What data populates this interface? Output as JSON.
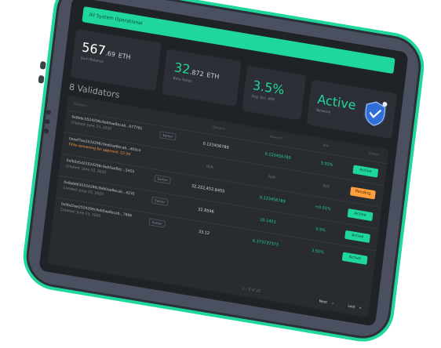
{
  "banner": {
    "text": "All System Operational"
  },
  "stats": [
    {
      "value": "567",
      "fraction": ".69",
      "unit": "ETH",
      "label": "Sum Balance"
    },
    {
      "value": "32",
      "fraction": ".872",
      "unit": "ETH",
      "label": "Beta Rates"
    },
    {
      "value": "3.5%",
      "label": "Avg. Est. APR"
    },
    {
      "value": "Active",
      "label": "Network"
    }
  ],
  "validators_title": "8 Validators",
  "table": {
    "headers": [
      "Validator",
      "Balance",
      "Reward",
      "APR",
      "Status"
    ],
    "rows": [
      {
        "id": "0x8ebc5524296c9eb0ae8ecab...077781",
        "sub": "Created: June 23, 2020",
        "tag": "Earlier",
        "balance": "0.123456789",
        "reward": "0.123456789",
        "apr": "3.55%",
        "status": "Active"
      },
      {
        "id": "0xeef7ee2524296c9eb0ae8ecab...d63c4",
        "sub": "Time remaining for approval: 22:34",
        "warn": true,
        "balance": "N/A",
        "reward": "N/A",
        "apr": "N/A",
        "status": "Pending"
      },
      {
        "id": "0xfb0d5d22524296c9eb0ae8ec...5455",
        "sub": "Created: June 23, 2020",
        "tag": "Earlier",
        "balance": "32,222,452.8455",
        "reward": "0.123456789",
        "apr": "+0.01%",
        "status": "Active"
      },
      {
        "id": "0x8ab6632524296c9eb0ae8ecab...4232",
        "sub": "Created: June 23, 2020",
        "tag": "Earlier",
        "balance": "32.8596",
        "reward": "10.1451",
        "apr": "0.9%",
        "status": "Active"
      },
      {
        "id": "0x9bd2ee2524296c9eb0ae8ecab...7999",
        "sub": "Created: June 23, 2020",
        "tag": "Earlier",
        "balance": "33.12",
        "reward": "6.373737373",
        "apr": "3.55%",
        "status": "Active"
      }
    ],
    "pagination": {
      "text": "1 – 5 of 25",
      "next": "Next",
      "last": "Last"
    }
  },
  "colors": {
    "accent": "#1fd79c",
    "pending": "#ff9e3b",
    "screen": "#1f2226",
    "card": "#2c3036"
  },
  "icons": {
    "network": "shield-check-icon"
  }
}
